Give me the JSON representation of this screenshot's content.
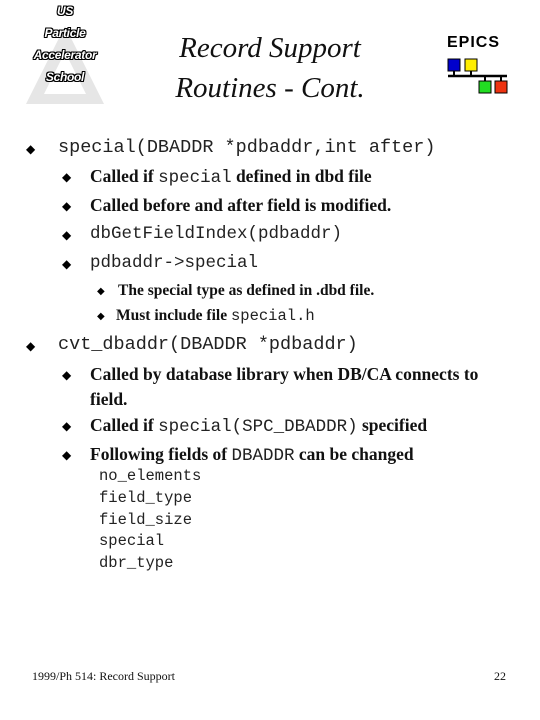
{
  "logo": {
    "lines": [
      "US",
      "Particle",
      "Accelerator",
      "School"
    ]
  },
  "title": {
    "line1": "Record Support",
    "line2": "Routines - Cont."
  },
  "epics": {
    "label": "EPICS",
    "colors": {
      "blue": "#0000cc",
      "yellow": "#ffee00",
      "green": "#22dd22",
      "red": "#ee3311"
    }
  },
  "content": {
    "bullet_glyph": "◆",
    "special": {
      "signature": "special(DBADDR *pdbaddr,int after)",
      "items": [
        {
          "pre": "Called if ",
          "code": "special",
          "post": " defined in dbd file"
        },
        {
          "text": "Called before and after field is modified."
        },
        {
          "code": "dbGetFieldIndex(pdbaddr)"
        },
        {
          "code": "pdbaddr->special"
        }
      ],
      "subitems": [
        {
          "text": "The special type as defined in .dbd file."
        },
        {
          "pre": "Must include file ",
          "code": "special.h"
        }
      ]
    },
    "cvt": {
      "signature": "cvt_dbaddr(DBADDR *pdbaddr)",
      "items": [
        {
          "line1": "Called by database library when DB/CA connects to",
          "line2": "field."
        },
        {
          "pre": "Called if ",
          "code": "special(SPC_DBADDR)",
          "post": " specified"
        },
        {
          "pre": "Following fields of ",
          "code": "DBADDR",
          "post": " can be changed"
        }
      ],
      "fields": [
        "no_elements",
        "field_type",
        "field_size",
        "special",
        "dbr_type"
      ]
    }
  },
  "footer": {
    "left": "1999/Ph 514: Record Support",
    "page": "22"
  }
}
